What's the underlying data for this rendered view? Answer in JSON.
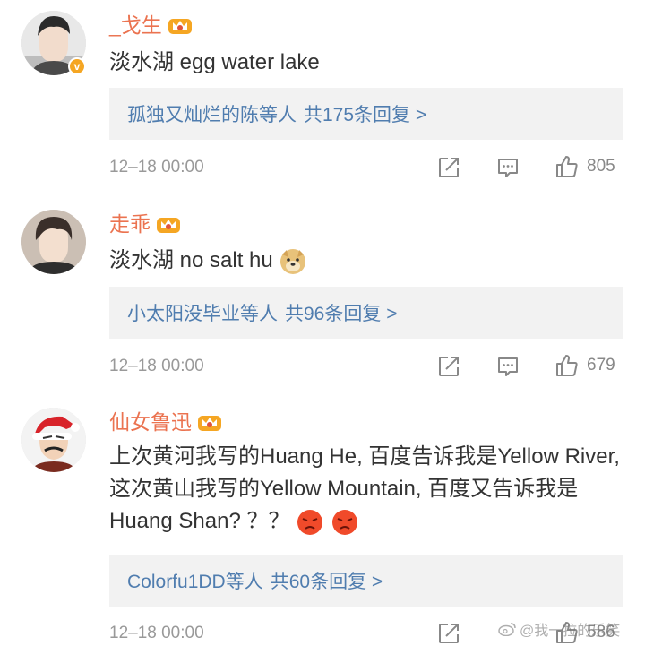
{
  "comments": [
    {
      "username": "_戈生",
      "text": "淡水湖  egg water lake",
      "replies_prefix": "孤独又灿烂的陈等人",
      "replies_count": "共175条回复 >",
      "time": "12–18 00:00",
      "likes": "805"
    },
    {
      "username": "走乖",
      "text": "淡水湖  no salt hu",
      "replies_prefix": "小太阳没毕业等人",
      "replies_count": "共96条回复 >",
      "time": "12–18 00:00",
      "likes": "679"
    },
    {
      "username": "仙女鲁迅",
      "text": "上次黄河我写的Huang He, 百度告诉我是Yellow River, 这次黄山我写的Yellow Mountain, 百度又告诉我是Huang Shan? ？？",
      "replies_prefix": "Colorfu1DD等人",
      "replies_count": "共60条回复 >",
      "time": "12–18 00:00",
      "likes": "586"
    }
  ],
  "watermark": "@我一拉的乐笑",
  "colors": {
    "username": "#eb7350",
    "link": "#507daf",
    "meta": "#999999"
  }
}
